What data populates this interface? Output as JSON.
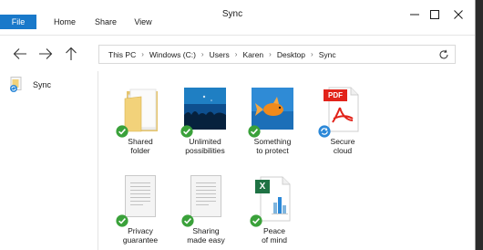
{
  "window": {
    "title": "Sync"
  },
  "ribbon": {
    "tabs": [
      {
        "label": "File"
      },
      {
        "label": "Home"
      },
      {
        "label": "Share"
      },
      {
        "label": "View"
      }
    ]
  },
  "address": {
    "crumbs": [
      "This PC",
      "Windows (C:)",
      "Users",
      "Karen",
      "Desktop",
      "Sync"
    ]
  },
  "sidebar": {
    "items": [
      {
        "label": "Sync",
        "icon": "sync-folder-icon"
      }
    ]
  },
  "files": [
    {
      "name": "Shared\nfolder",
      "line1": "Shared",
      "line2": "folder",
      "type": "folder",
      "status": "synced"
    },
    {
      "name": "Unlimited possibilities",
      "line1": "Unlimited",
      "line2": "possibilities",
      "type": "image",
      "status": "synced"
    },
    {
      "name": "Something to protect",
      "line1": "Something",
      "line2": "to protect",
      "type": "image",
      "status": "synced"
    },
    {
      "name": "Secure cloud",
      "line1": "Secure",
      "line2": "cloud",
      "type": "pdf",
      "status": "syncing"
    },
    {
      "name": "Privacy guarantee",
      "line1": "Privacy",
      "line2": "guarantee",
      "type": "text",
      "status": "synced"
    },
    {
      "name": "Sharing made easy",
      "line1": "Sharing",
      "line2": "made easy",
      "type": "text",
      "status": "synced"
    },
    {
      "name": "Peace of mind",
      "line1": "Peace",
      "line2": "of mind",
      "type": "excel",
      "status": "synced"
    }
  ],
  "pdf_label": "PDF",
  "excel_label": "X",
  "colors": {
    "accent": "#1979ca",
    "synced": "#3aa13a",
    "syncing": "#2b88d8",
    "pdf": "#e2231a",
    "excel": "#1f7244"
  }
}
